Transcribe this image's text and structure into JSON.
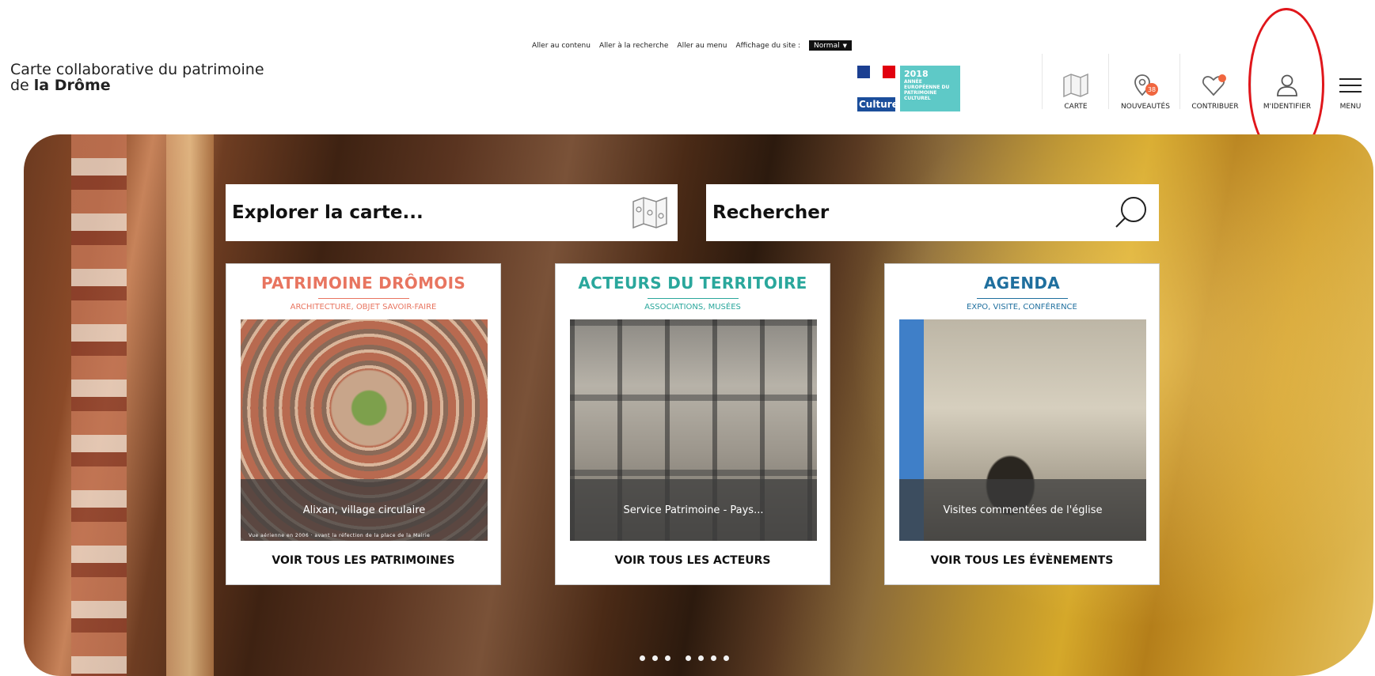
{
  "skiplinks": {
    "content": "Aller au contenu",
    "search": "Aller à la recherche",
    "menu": "Aller au menu",
    "display_label": "Affichage du site :",
    "display_value": "Normal"
  },
  "site": {
    "title_line1": "Carte collaborative du patrimoine",
    "title_line2_prefix": "de",
    "title_line2_bold": "la Drôme"
  },
  "logos": {
    "culture": "Culture",
    "annee_year": "2018",
    "annee_text": "ANNÉE EUROPÉENNE DU PATRIMOINE CULTUREL"
  },
  "nav": {
    "carte": "CARTE",
    "nouveautes": "NOUVEAUTÉS",
    "contribuer": "CONTRIBUER",
    "identifier": "M'IDENTIFIER",
    "menu": "MENU",
    "badge": "38"
  },
  "bars": {
    "explore": "Explorer la carte...",
    "search": "Rechercher"
  },
  "cards": [
    {
      "title": "PATRIMOINE DRÔMOIS",
      "subtitle": "ARCHITECTURE, OBJET SAVOIR-FAIRE",
      "caption": "Alixan, village circulaire",
      "credit": "Vue aérienne en 2006 · avant la réfection de la place de la Mairie",
      "link": "VOIR TOUS LES PATRIMOINES",
      "color": "#e87560"
    },
    {
      "title": "ACTEURS DU TERRITOIRE",
      "subtitle": "ASSOCIATIONS, MUSÉES",
      "caption": "Service Patrimoine - Pays...",
      "link": "VOIR TOUS LES ACTEURS",
      "color": "#2aa79c"
    },
    {
      "title": "AGENDA",
      "subtitle": "EXPO, VISITE, CONFÉRENCE",
      "caption": "Visites commentées de l'église",
      "link": "VOIR TOUS LES ÉVÈNEMENTS",
      "color": "#1f6f9e"
    }
  ]
}
